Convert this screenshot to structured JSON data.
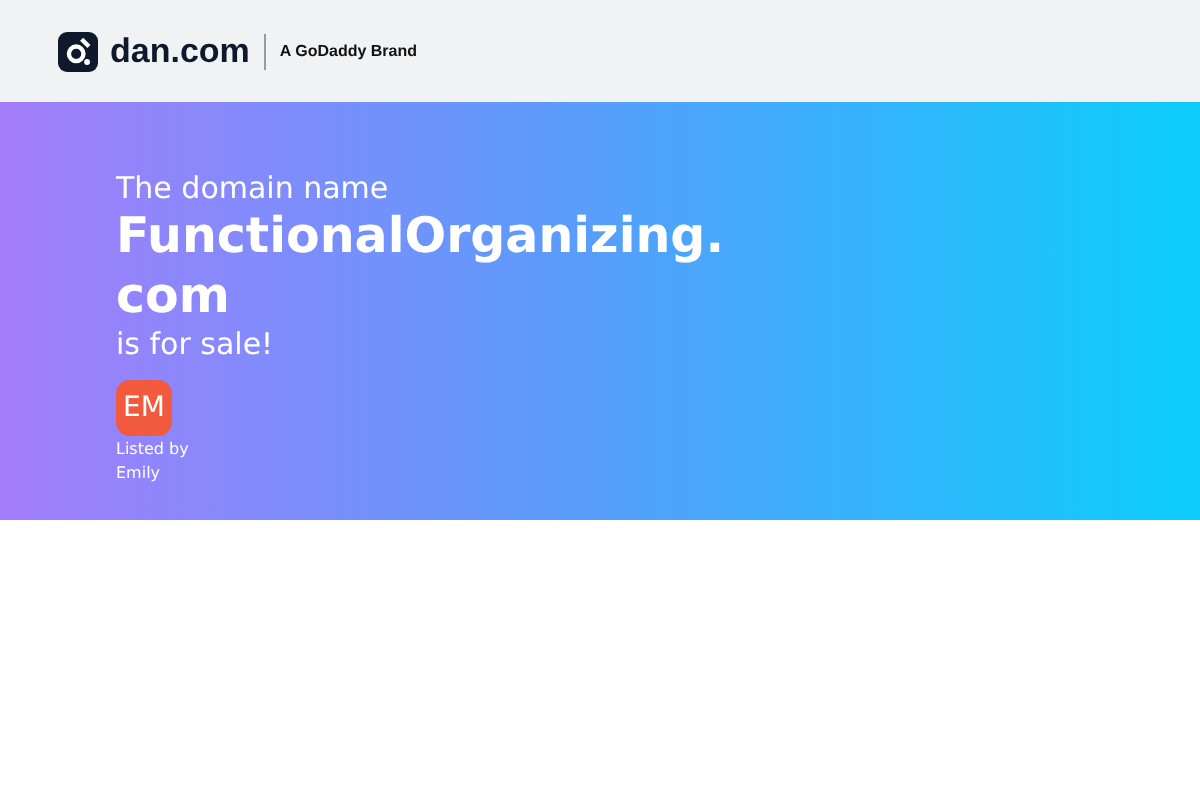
{
  "header": {
    "logo_text": "dan.com",
    "brand_note": "A GoDaddy Brand"
  },
  "hero": {
    "intro": "The domain name",
    "domain": "FunctionalOrganizing.com",
    "status": "is for sale!",
    "seller": {
      "initials": "EM",
      "listed_by": "Listed by",
      "name": "Emily"
    }
  }
}
